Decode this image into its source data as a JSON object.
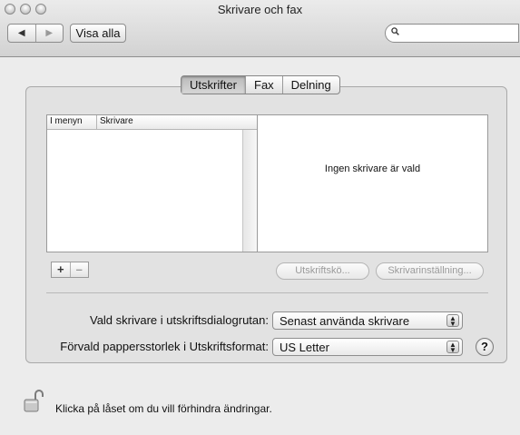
{
  "window": {
    "title": "Skrivare och fax"
  },
  "toolbar": {
    "show_all_label": "Visa alla",
    "nav_back_icon": "triangle-left",
    "nav_forward_icon": "triangle-right",
    "search": {
      "value": "",
      "placeholder": ""
    }
  },
  "tabs": [
    {
      "label": "Utskrifter",
      "active": true
    },
    {
      "label": "Fax",
      "active": false
    },
    {
      "label": "Delning",
      "active": false
    }
  ],
  "printer_list": {
    "columns": [
      "I menyn",
      "Skrivare"
    ],
    "rows": []
  },
  "detail": {
    "empty_message": "Ingen skrivare är vald"
  },
  "list_controls": {
    "add_label": "+",
    "remove_label": "–"
  },
  "buttons": {
    "print_queue_label": "Utskriftskö...",
    "printer_settings_label": "Skrivarinställning..."
  },
  "settings": {
    "selected_printer_label": "Vald skrivare i utskriftsdialogrutan:",
    "selected_printer_value": "Senast använda skrivare",
    "paper_size_label": "Förvald pappersstorlek i Utskriftsformat:",
    "paper_size_value": "US Letter"
  },
  "help_label": "?",
  "footer": {
    "lock_text": "Klicka på låset om du vill förhindra ändringar."
  }
}
